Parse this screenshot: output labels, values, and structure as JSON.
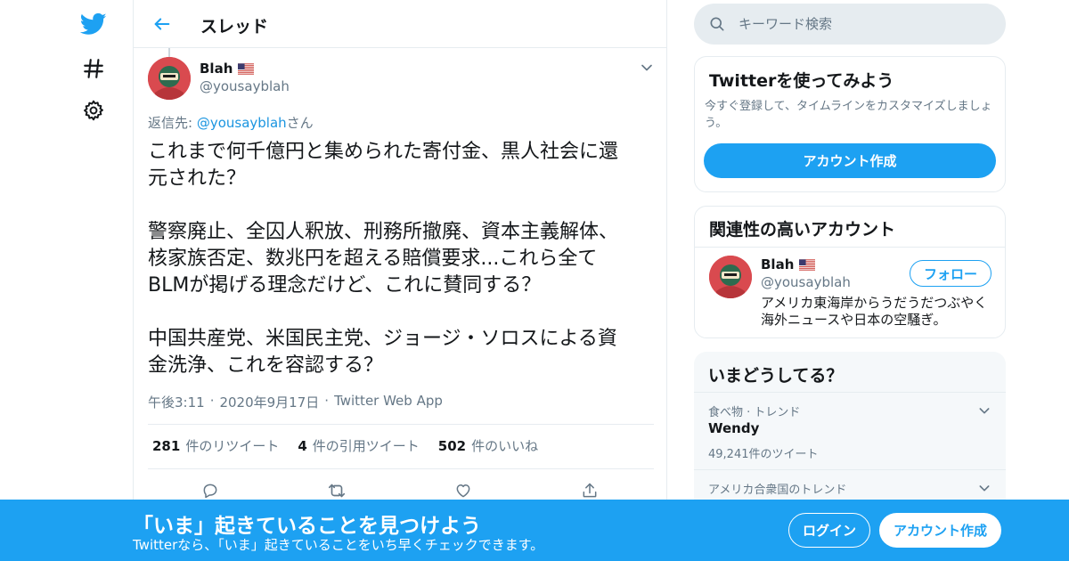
{
  "header": {
    "title": "スレッド"
  },
  "tweet": {
    "author": {
      "name": "Blah",
      "flag": "us-flag-icon",
      "handle": "@yousayblah"
    },
    "reply_to": {
      "prefix": "返信先: ",
      "mention": "@yousayblah",
      "suffix": "さん"
    },
    "paragraphs": [
      [
        "これまで何千億円と集められた寄付金、黒人社会に還",
        "元された？"
      ],
      [
        "警察廃止、全囚人釈放、刑務所撤廃、資本主義解体、",
        "核家族否定、数兆円を超える賠償要求...これら全て",
        "BLMが掲げる理念だけど、これに賛同する？"
      ],
      [
        "中国共産党、米国民主党、ジョージ・ソロスによる資",
        "金洗浄、これを容認する？"
      ]
    ],
    "time": "午後3:11",
    "date": "2020年9月17日",
    "source": "Twitter Web App",
    "separator": "·",
    "stats": {
      "retweets": {
        "count": "281",
        "label": "件のリツイート"
      },
      "quotes": {
        "count": "4",
        "label": "件の引用ツイート"
      },
      "likes": {
        "count": "502",
        "label": "件のいいね"
      }
    }
  },
  "search": {
    "placeholder": "キーワード検索"
  },
  "signup_card": {
    "title": "Twitterを使ってみよう",
    "description": "今すぐ登録して、タイムラインをカスタマイズしましょう。",
    "button": "アカウント作成"
  },
  "related": {
    "title": "関連性の高いアカウント",
    "account": {
      "name": "Blah",
      "handle": "@yousayblah",
      "follow_label": "フォロー",
      "bio": "アメリカ東海岸からうだうだつぶやく海外ニュースや日本の空騒ぎ。"
    }
  },
  "trends": {
    "title": "いまどうしてる？",
    "items": [
      {
        "context": "食べ物 · トレンド",
        "name": "Wendy",
        "count": "49,241件のツイート"
      },
      {
        "context": "アメリカ合衆国のトレンド",
        "name": "",
        "count": ""
      }
    ]
  },
  "banner": {
    "title": "「いま」起きていることを見つけよう",
    "subtitle": "Twitterなら、「いま」起きていることをいち早くチェックできます。",
    "login": "ログイン",
    "signup": "アカウント作成"
  },
  "colors": {
    "accent": "#1da1f2",
    "text_primary": "#14171a",
    "text_secondary": "#657786",
    "border": "#e6ecf0",
    "trends_background": "#f5f8fa"
  }
}
